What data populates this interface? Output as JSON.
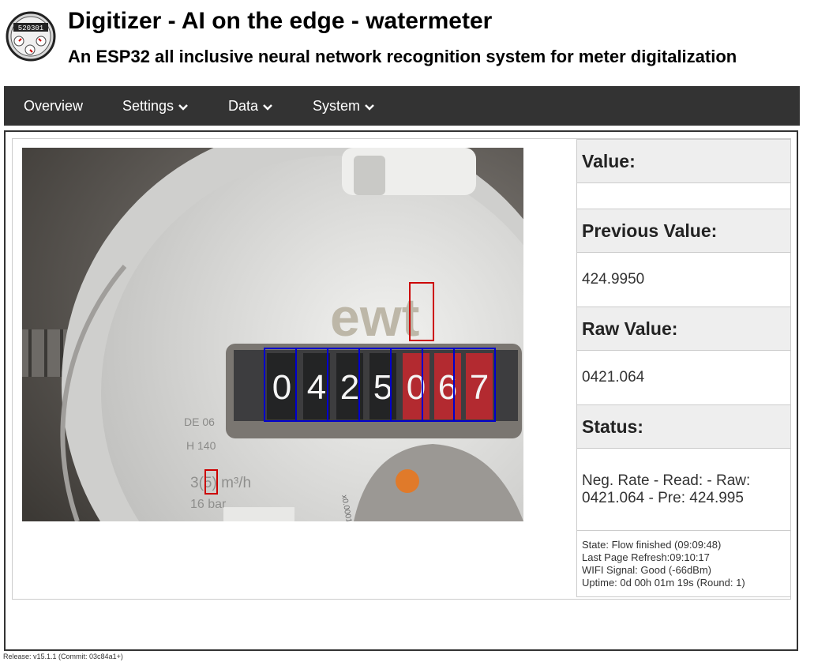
{
  "header": {
    "title": "Digitizer - AI on the edge - watermeter",
    "subtitle": "An ESP32 all inclusive neural network recognition system for meter digitalization",
    "logo_digits": "520301"
  },
  "nav": {
    "items": [
      {
        "label": "Overview",
        "dropdown": false
      },
      {
        "label": "Settings",
        "dropdown": true
      },
      {
        "label": "Data",
        "dropdown": true
      },
      {
        "label": "System",
        "dropdown": true
      }
    ]
  },
  "camera": {
    "brand_text": "ewt",
    "digits": [
      "0",
      "4",
      "2",
      "5",
      "0",
      "6",
      "7"
    ],
    "plate_text_1": "DE 06",
    "plate_text_2": "H 140",
    "unit_text": "3(5) m³/h",
    "pressure_text": "16 bar",
    "dial_text": "x0.0001",
    "roi_digit_color": "#0000cc",
    "roi_analog_color": "#cc0000"
  },
  "status": {
    "value_label": "Value:",
    "value": "",
    "previous_label": "Previous Value:",
    "previous": "424.9950",
    "raw_label": "Raw Value:",
    "raw": "0421.064",
    "status_label": "Status:",
    "status_line1": "Neg. Rate - Read: - Raw:",
    "status_line2": "0421.064 - Pre: 424.995",
    "state": "State: Flow finished (09:09:48)",
    "refresh": "Last Page Refresh:09:10:17",
    "wifi": "WIFI Signal: Good (-66dBm)",
    "uptime": "Uptime: 0d 00h 01m 19s (Round: 1)"
  },
  "footer": {
    "release": "Release: v15.1.1 (Commit: 03c84a1+)"
  },
  "colors": {
    "navbar": "#333333",
    "header_cell": "#eeeeee"
  }
}
